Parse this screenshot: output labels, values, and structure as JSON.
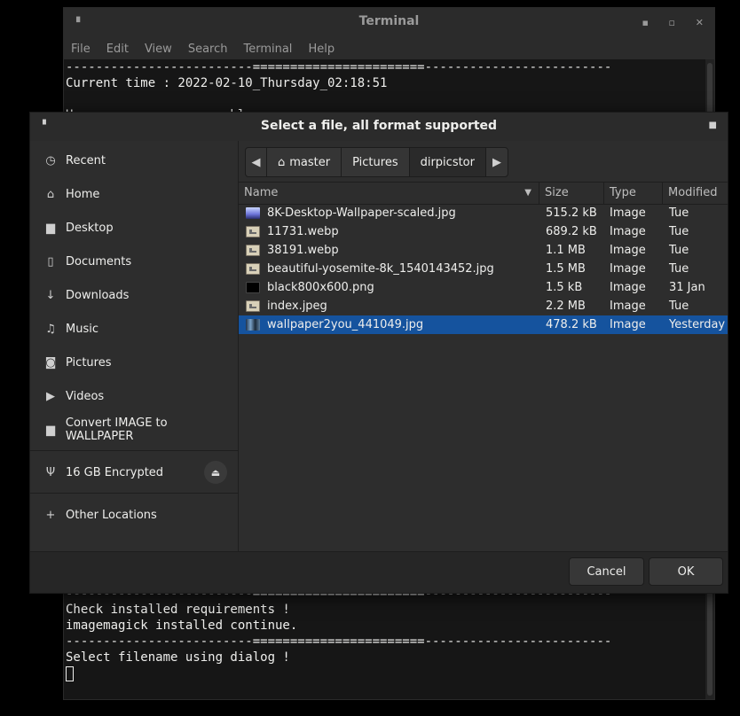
{
  "terminal": {
    "title": "Terminal",
    "menu": [
      "File",
      "Edit",
      "View",
      "Search",
      "Terminal",
      "Help"
    ],
    "lines_top": [
      "-------------------------=======================-------------------------",
      "Current time : 2022-02-10_Thursday_02:18:51",
      "",
      "Hav                   hly                        "
    ],
    "lines_bottom": [
      "-------------------------=======================-------------------------",
      "Check installed requirements !",
      "imagemagick installed continue.",
      "-------------------------=======================-------------------------",
      "Select filename using dialog !"
    ]
  },
  "dialog": {
    "title": "Select a file, all format supported",
    "sidebar": [
      {
        "icon": "clock-icon",
        "label": "Recent"
      },
      {
        "icon": "home-icon",
        "label": "Home"
      },
      {
        "icon": "folder-icon",
        "label": "Desktop"
      },
      {
        "icon": "document-icon",
        "label": "Documents"
      },
      {
        "icon": "download-icon",
        "label": "Downloads"
      },
      {
        "icon": "music-icon",
        "label": "Music"
      },
      {
        "icon": "camera-icon",
        "label": "Pictures"
      },
      {
        "icon": "video-icon",
        "label": "Videos"
      },
      {
        "icon": "folder-icon",
        "label": "Convert IMAGE to WALLPAPER"
      }
    ],
    "drive": {
      "icon": "usb-icon",
      "label": "16 GB Encrypted"
    },
    "other_locations": "Other Locations",
    "path": [
      "master",
      "Pictures",
      "dirpicstor"
    ],
    "columns": {
      "name": "Name",
      "size": "Size",
      "type": "Type",
      "modified": "Modified"
    },
    "files": [
      {
        "name": "8K-Desktop-Wallpaper-scaled.jpg",
        "size": "515.2 kB",
        "type": "Image",
        "modified": "Tue",
        "icon": "wallpaper-thumbnail"
      },
      {
        "name": "11731.webp",
        "size": "689.2 kB",
        "type": "Image",
        "modified": "Tue",
        "icon": "image-icon"
      },
      {
        "name": "38191.webp",
        "size": "1.1 MB",
        "type": "Image",
        "modified": "Tue",
        "icon": "image-icon"
      },
      {
        "name": "beautiful-yosemite-8k_1540143452.jpg",
        "size": "1.5 MB",
        "type": "Image",
        "modified": "Tue",
        "icon": "image-icon"
      },
      {
        "name": "black800x600.png",
        "size": "1.5 kB",
        "type": "Image",
        "modified": "31 Jan",
        "icon": "black-thumbnail"
      },
      {
        "name": "index.jpeg",
        "size": "2.2 MB",
        "type": "Image",
        "modified": "Tue",
        "icon": "image-icon"
      },
      {
        "name": "wallpaper2you_441049.jpg",
        "size": "478.2 kB",
        "type": "Image",
        "modified": "Yesterday",
        "icon": "photo-thumbnail",
        "selected": true
      }
    ],
    "buttons": {
      "cancel": "Cancel",
      "ok": "OK"
    },
    "selection_color": "#15539e"
  }
}
